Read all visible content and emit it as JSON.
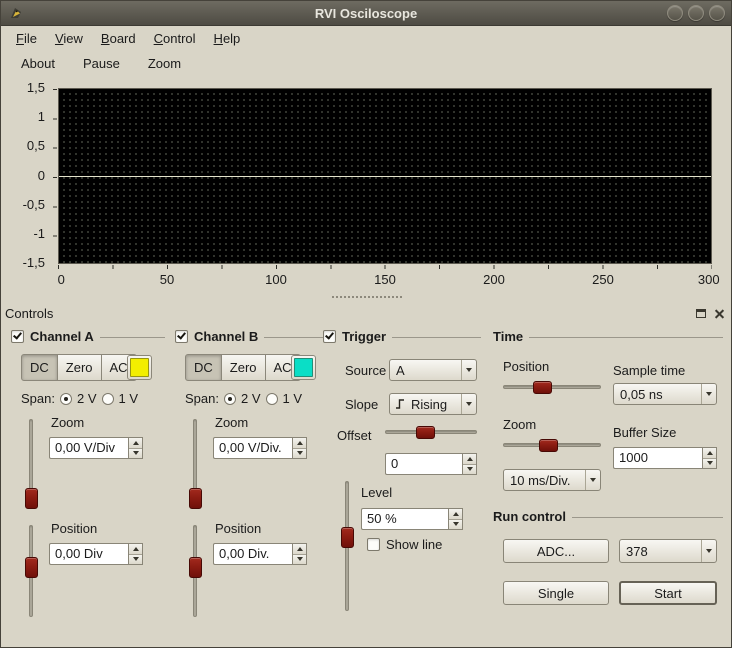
{
  "titlebar": {
    "title": "RVI Osciloscope"
  },
  "menubar": {
    "items": [
      "File",
      "View",
      "Board",
      "Control",
      "Help"
    ]
  },
  "toolbar": {
    "items": [
      "About",
      "Pause",
      "Zoom"
    ]
  },
  "scope": {
    "y_ticks": [
      "1,5",
      "1",
      "0,5",
      "0",
      "-0,5",
      "-1",
      "-1,5"
    ],
    "x_ticks": [
      "0",
      "50",
      "100",
      "150",
      "200",
      "250",
      "300"
    ],
    "trace_color": "#e3e3cb"
  },
  "dock": {
    "title": "Controls"
  },
  "channel_a": {
    "title": "Channel A",
    "dc": "DC",
    "zero": "Zero",
    "ac": "AC",
    "color": "#f2ee00",
    "span_label": "Span:",
    "span_2v": "2 V",
    "span_1v": "1 V",
    "zoom_label": "Zoom",
    "zoom_value": "0,00 V/Div",
    "position_label": "Position",
    "position_value": "0,00 Div"
  },
  "channel_b": {
    "title": "Channel B",
    "dc": "DC",
    "zero": "Zero",
    "ac": "AC",
    "color": "#0adec6",
    "span_label": "Span:",
    "span_2v": "2 V",
    "span_1v": "1 V",
    "zoom_label": "Zoom",
    "zoom_value": "0,00 V/Div.",
    "position_label": "Position",
    "position_value": "0,00 Div."
  },
  "trigger": {
    "title": "Trigger",
    "source_label": "Source",
    "source_value": "A",
    "slope_label": "Slope",
    "slope_value": "Rising",
    "offset_label": "Offset",
    "offset_value": "0",
    "level_label": "Level",
    "level_value": "50 %",
    "show_line_label": "Show line"
  },
  "time": {
    "title": "Time",
    "position_label": "Position",
    "zoom_label": "Zoom",
    "zoom_value": "10 ms/Div.",
    "sample_time_label": "Sample time",
    "sample_time_value": "0,05 ns",
    "buffer_label": "Buffer Size",
    "buffer_value": "1000"
  },
  "run": {
    "title": "Run control",
    "adc_button": "ADC...",
    "adc_value": "378",
    "single_button": "Single",
    "start_button": "Start"
  }
}
